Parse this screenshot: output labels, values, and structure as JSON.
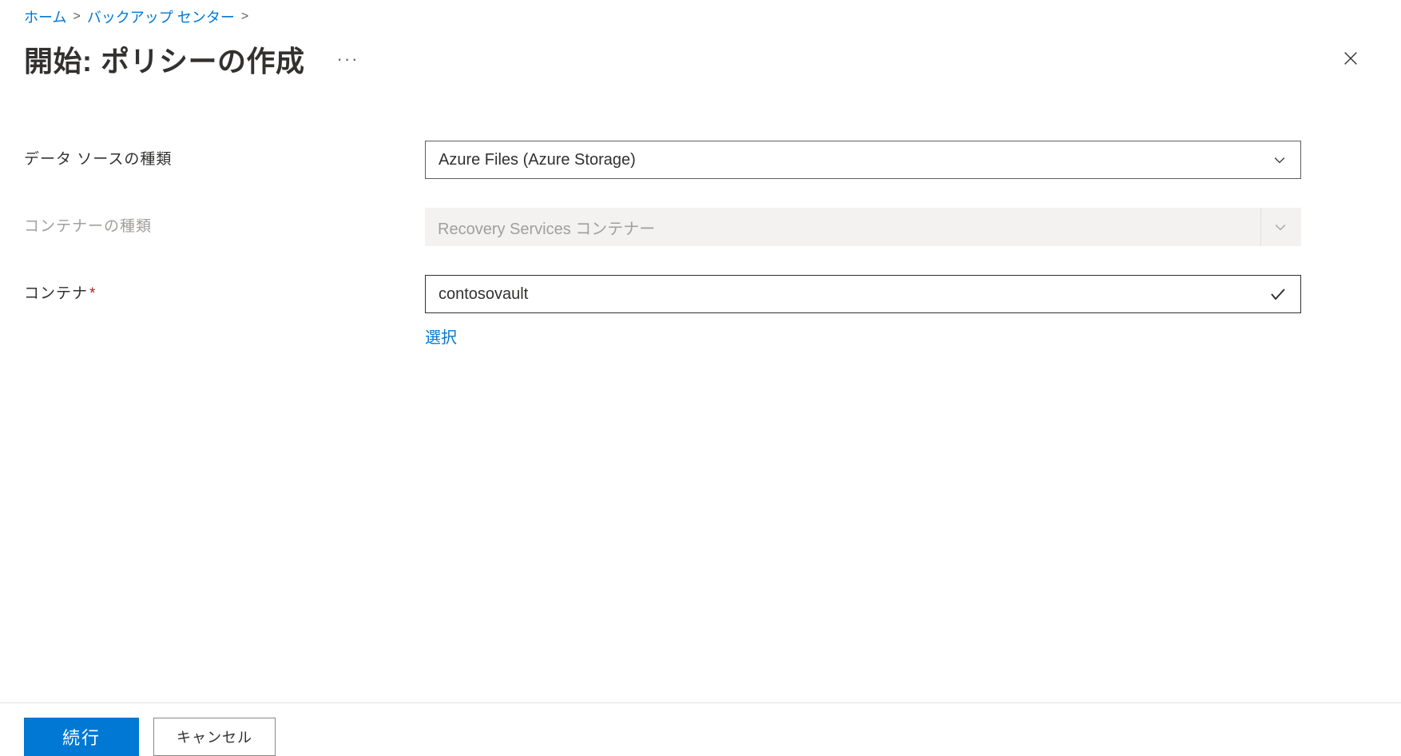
{
  "breadcrumb": {
    "home": "ホーム",
    "backup_center": "バックアップ センター"
  },
  "header": {
    "title": "開始: ポリシーの作成",
    "ellipsis": "···"
  },
  "form": {
    "datasource_type": {
      "label": "データ ソースの種類",
      "value": "Azure Files (Azure Storage)"
    },
    "container_type": {
      "label": "コンテナーの種類",
      "value": "Recovery Services コンテナー"
    },
    "container": {
      "label": "コンテナ",
      "value": "contosovault",
      "select_link": "選択"
    }
  },
  "footer": {
    "continue": "続行",
    "cancel": "キャンセル"
  }
}
